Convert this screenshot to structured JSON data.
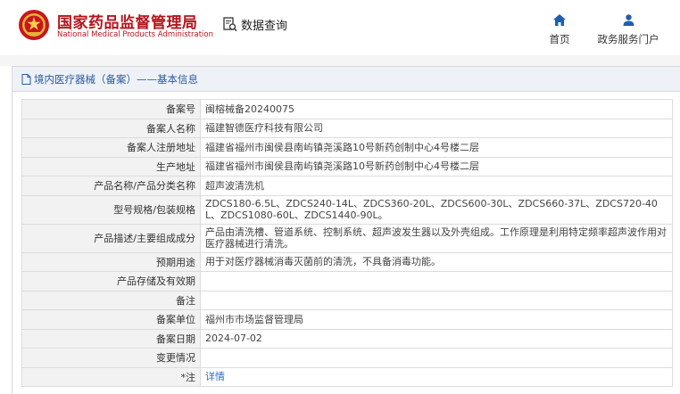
{
  "header": {
    "brand_cn": "国家药品监督管理局",
    "brand_en": "National Medical Products Administration",
    "query_label": "数据查询",
    "nav": [
      {
        "icon": "home-icon",
        "label": "首页"
      },
      {
        "icon": "user-icon",
        "label": "政务服务门户"
      }
    ]
  },
  "panel": {
    "title": "境内医疗器械（备案）——基本信息"
  },
  "record": {
    "rows": [
      {
        "label": "备案号",
        "value": "闽榕械备20240075"
      },
      {
        "label": "备案人名称",
        "value": "福建智德医疗科技有限公司"
      },
      {
        "label": "备案人注册地址",
        "value": "福建省福州市闽侯县南屿镇尧溪路10号新药创制中心4号楼二层"
      },
      {
        "label": "生产地址",
        "value": "福建省福州市闽侯县南屿镇尧溪路10号新药创制中心4号楼二层"
      },
      {
        "label": "产品名称/产品分类名称",
        "value": "超声波清洗机"
      },
      {
        "label": "型号规格/包装规格",
        "value": "ZDCS180-6.5L、ZDCS240-14L、ZDCS360-20L、ZDCS600-30L、ZDCS660-37L、ZDCS720-40L、ZDCS1080-60L、ZDCS1440-90L。"
      },
      {
        "label": "产品描述/主要组成成分",
        "value": "产品由清洗槽、管道系统、控制系统、超声波发生器以及外壳组成。工作原理是利用特定频率超声波作用对医疗器械进行清洗。"
      },
      {
        "label": "预期用途",
        "value": "用于对医疗器械消毒灭菌前的清洗，不具备消毒功能。"
      },
      {
        "label": "产品存储及有效期",
        "value": ""
      },
      {
        "label": "备注",
        "value": ""
      },
      {
        "label": "备案单位",
        "value": "福州市市场监督管理局"
      },
      {
        "label": "备案日期",
        "value": "2024-07-02"
      },
      {
        "label": "变更情况",
        "value": ""
      },
      {
        "label": "*注",
        "value": "详情"
      }
    ]
  },
  "colors": {
    "brand_red": "#b5141c",
    "nav_blue": "#1f5fb0",
    "link_blue": "#2a6cc4",
    "label_bg": "#f2f2f2",
    "header_band": "#eef2f7"
  }
}
